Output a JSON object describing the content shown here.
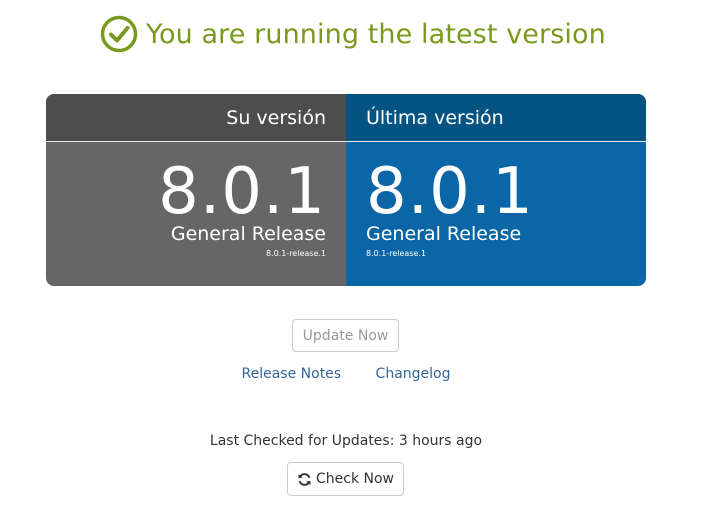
{
  "status": {
    "icon": "check-circle-icon",
    "message": "You are running the latest version",
    "color": "#7a9a1e"
  },
  "current_version": {
    "header": "Su versión",
    "version": "8.0.1",
    "release_name": "General Release",
    "release_tag": "8.0.1-release.1",
    "color": "#666666"
  },
  "latest_version": {
    "header": "Última versión",
    "version": "8.0.1",
    "release_name": "General Release",
    "release_tag": "8.0.1-release.1",
    "color": "#0a66a6"
  },
  "actions": {
    "update_now_label": "Update Now",
    "release_notes_label": "Release Notes",
    "changelog_label": "Changelog",
    "last_checked_text": "Last Checked for Updates: 3 hours ago",
    "check_now_label": "Check Now",
    "check_now_icon": "refresh-icon"
  }
}
